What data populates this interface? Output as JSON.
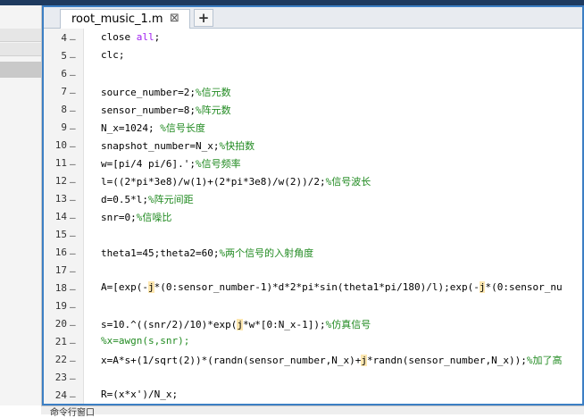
{
  "editor": {
    "tab_label": "root_music_1.m",
    "close_glyph": "⊠",
    "add_glyph": "+",
    "lines": [
      {
        "num": "4",
        "parts": [
          {
            "t": "close ",
            "k": "n"
          },
          {
            "t": "all",
            "k": "s"
          },
          {
            "t": ";",
            "k": "n"
          }
        ]
      },
      {
        "num": "5",
        "parts": [
          {
            "t": "clc;",
            "k": "n"
          }
        ]
      },
      {
        "num": "6",
        "parts": []
      },
      {
        "num": "7",
        "parts": [
          {
            "t": "source_number=2;",
            "k": "n"
          },
          {
            "t": "%信元数",
            "k": "c"
          }
        ]
      },
      {
        "num": "8",
        "parts": [
          {
            "t": "sensor_number=8;",
            "k": "n"
          },
          {
            "t": "%阵元数",
            "k": "c"
          }
        ]
      },
      {
        "num": "9",
        "parts": [
          {
            "t": "N_x=1024; ",
            "k": "n"
          },
          {
            "t": "%信号长度",
            "k": "c"
          }
        ]
      },
      {
        "num": "10",
        "parts": [
          {
            "t": "snapshot_number=N_x;",
            "k": "n"
          },
          {
            "t": "%快拍数",
            "k": "c"
          }
        ]
      },
      {
        "num": "11",
        "parts": [
          {
            "t": "w=[pi/4 pi/6].';",
            "k": "n"
          },
          {
            "t": "%信号频率",
            "k": "c"
          }
        ]
      },
      {
        "num": "12",
        "parts": [
          {
            "t": "l=((2*pi*3e8)/w(1)+(2*pi*3e8)/w(2))/2;",
            "k": "n"
          },
          {
            "t": "%信号波长",
            "k": "c"
          }
        ]
      },
      {
        "num": "13",
        "parts": [
          {
            "t": "d=0.5*l;",
            "k": "n"
          },
          {
            "t": "%阵元间距",
            "k": "c"
          }
        ]
      },
      {
        "num": "14",
        "parts": [
          {
            "t": "snr=0;",
            "k": "n"
          },
          {
            "t": "%信噪比",
            "k": "c"
          }
        ]
      },
      {
        "num": "15",
        "parts": []
      },
      {
        "num": "16",
        "parts": [
          {
            "t": "theta1=45;theta2=60;",
            "k": "n"
          },
          {
            "t": "%两个信号的入射角度",
            "k": "c"
          }
        ]
      },
      {
        "num": "17",
        "parts": []
      },
      {
        "num": "18",
        "parts": [
          {
            "t": "A=[exp(-",
            "k": "n"
          },
          {
            "t": "j",
            "k": "j"
          },
          {
            "t": "*(0:sensor_number-1)*d*2*pi*sin(theta1*pi/180)/l);exp(-",
            "k": "n"
          },
          {
            "t": "j",
            "k": "j"
          },
          {
            "t": "*(0:sensor_nu",
            "k": "n"
          }
        ]
      },
      {
        "num": "19",
        "parts": []
      },
      {
        "num": "20",
        "parts": [
          {
            "t": "s=10.^((snr/2)/10)*exp(",
            "k": "n"
          },
          {
            "t": "j",
            "k": "j"
          },
          {
            "t": "*w*[0:N_x-1]);",
            "k": "n"
          },
          {
            "t": "%仿真信号",
            "k": "c"
          }
        ]
      },
      {
        "num": "21",
        "parts": [
          {
            "t": "%x=awgn(s,snr);",
            "k": "c"
          }
        ]
      },
      {
        "num": "22",
        "parts": [
          {
            "t": "x=A*s+(1/sqrt(2))*(randn(sensor_number,N_x)+",
            "k": "n"
          },
          {
            "t": "j",
            "k": "j"
          },
          {
            "t": "*randn(sensor_number,N_x));",
            "k": "n"
          },
          {
            "t": "%加了高",
            "k": "c"
          }
        ]
      },
      {
        "num": "23",
        "parts": []
      },
      {
        "num": "24",
        "parts": [
          {
            "t": "R=(x*x')/N_x;",
            "k": "n"
          }
        ]
      }
    ]
  },
  "bottom_panel": {
    "label": "命令行窗口"
  }
}
